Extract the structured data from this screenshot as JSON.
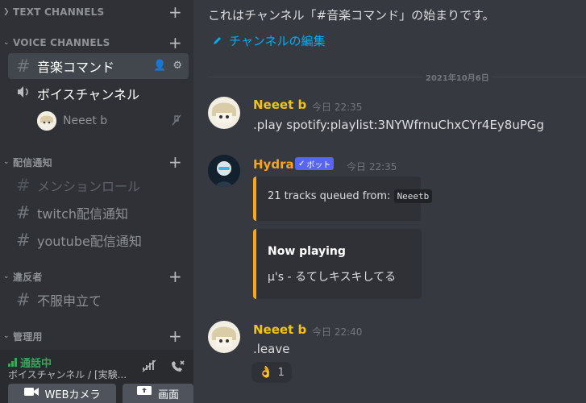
{
  "sidebar": {
    "categories": {
      "text": "TEXT CHANNELS",
      "voice": "VOICE CHANNELS",
      "notify": "配信通知",
      "violators": "違反者",
      "admin": "管理用"
    },
    "channels": {
      "music": "音楽コマンド",
      "voice": "ボイスチャンネル",
      "mention_role": "メンションロール",
      "twitch": "twitch配信通知",
      "youtube": "youtube配信通知",
      "appeal": "不服申立て"
    },
    "voice_user": "Neeet b"
  },
  "voice_panel": {
    "status": "通話中",
    "subtitle": "ボイスチャンネル / [実験...",
    "camera_label": "WEBカメラ",
    "screen_label": "画面"
  },
  "chat": {
    "intro": "これはチャンネル「#音楽コマンド」の始まりです。",
    "edit_channel": "チャンネルの編集",
    "date_divider": "2021年10月6日",
    "messages": [
      {
        "author": "Neeet b",
        "time": "今日 22:35",
        "text": ".play spotify:playlist:3NYWfrnuChxCYr4Ey8uPGg"
      },
      {
        "author": "Hydra",
        "badge": "ボット",
        "time": "今日 22:35",
        "embed1_text": "21 tracks queued from:",
        "embed1_code": "Neeetb",
        "embed2_title": "Now playing",
        "embed2_text": "μ's - るてしキスキしてる"
      },
      {
        "author": "Neeet b",
        "time": "今日 22:40",
        "text": ".leave",
        "reaction_count": "1"
      }
    ]
  },
  "colors": {
    "accent": "#5865f2",
    "author_neeet": "#f1c40f",
    "author_hydra": "#faa61a",
    "link": "#00aff4",
    "online": "#3ba55d"
  }
}
